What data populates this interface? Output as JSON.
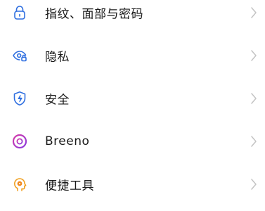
{
  "settings": {
    "items": [
      {
        "label": "指纹、面部与密码",
        "icon": "lock-icon",
        "color": "#2f6fe0"
      },
      {
        "label": "隐私",
        "icon": "privacy-eye-icon",
        "color": "#2f6fe0"
      },
      {
        "label": "安全",
        "icon": "shield-bolt-icon",
        "color": "#2f6fe0"
      },
      {
        "label": "Breeno",
        "icon": "breeno-ring-icon",
        "color": "#b23ad6"
      },
      {
        "label": "便捷工具",
        "icon": "head-tools-icon",
        "color": "#f0a020"
      }
    ]
  },
  "colors": {
    "chevron": "#c4c4c4",
    "text": "#1a1a1a",
    "background": "#ffffff"
  }
}
